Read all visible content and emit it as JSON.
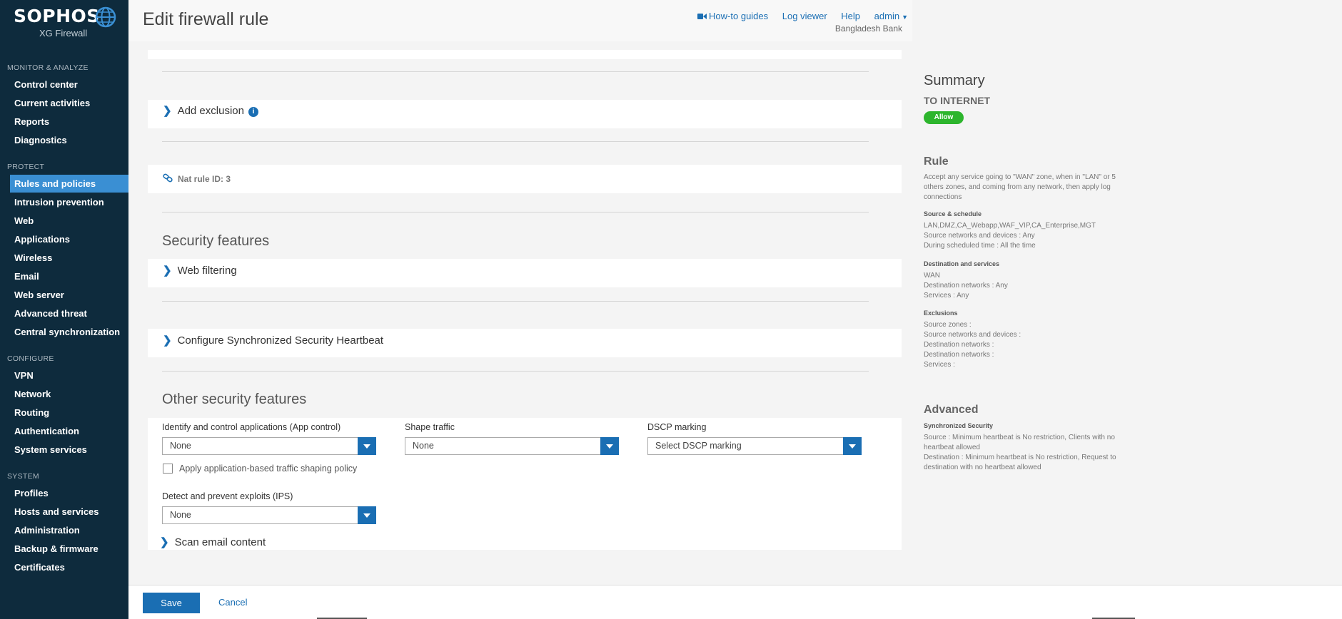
{
  "brand": {
    "name": "SOPHOS",
    "product": "XG Firewall"
  },
  "header": {
    "title": "Edit firewall rule",
    "links": {
      "howto": "How-to guides",
      "logviewer": "Log viewer",
      "help": "Help",
      "user": "admin"
    },
    "org": "Bangladesh Bank"
  },
  "nav": {
    "sections": {
      "monitor": "MONITOR & ANALYZE",
      "protect": "PROTECT",
      "configure": "CONFIGURE",
      "system": "SYSTEM"
    },
    "items": [
      "Control center",
      "Current activities",
      "Reports",
      "Diagnostics",
      "Rules and policies",
      "Intrusion prevention",
      "Web",
      "Applications",
      "Wireless",
      "Email",
      "Web server",
      "Advanced threat",
      "Central synchronization",
      "VPN",
      "Network",
      "Routing",
      "Authentication",
      "System services",
      "Profiles",
      "Hosts and services",
      "Administration",
      "Backup & firmware",
      "Certificates"
    ]
  },
  "main": {
    "add_exclusion": "Add exclusion",
    "nat_rule": "Nat rule ID: 3",
    "security_features": "Security features",
    "web_filtering": "Web filtering",
    "heartbeat": "Configure Synchronized Security Heartbeat",
    "other_features": "Other security features",
    "app_control_label": "Identify and control applications (App control)",
    "app_control_value": "None",
    "shape_traffic_label": "Shape traffic",
    "shape_traffic_value": "None",
    "dscp_label": "DSCP marking",
    "dscp_value": "Select DSCP marking",
    "app_shaping_checkbox": "Apply application-based traffic shaping policy",
    "ips_label": "Detect and prevent exploits (IPS)",
    "ips_value": "None",
    "scan_email": "Scan email content"
  },
  "summary": {
    "title": "Summary",
    "rule_name": "TO INTERNET",
    "action": "Allow",
    "rule_heading": "Rule",
    "rule_text": "Accept any service going to \"WAN\" zone, when in \"LAN\" or 5 others zones, and coming from any network, then apply log connections",
    "source_label": "Source & schedule",
    "source_zones": "LAN,DMZ,CA_Webapp,WAF_VIP,CA_Enterprise,MGT",
    "source_networks": "Source networks and devices : Any",
    "schedule": "During scheduled time : All the time",
    "dest_label": "Destination and services",
    "dest_zone": "WAN",
    "dest_networks": "Destination networks : Any",
    "services": "Services : Any",
    "excl_label": "Exclusions",
    "excl_source_zones": "Source zones :",
    "excl_source_networks": "Source networks and devices :",
    "excl_dest_networks_1": "Destination networks :",
    "excl_dest_networks_2": "Destination networks :",
    "excl_services": "Services :",
    "advanced_heading": "Advanced",
    "sync_label": "Synchronized Security",
    "sync_source": "Source : Minimum heartbeat is No restriction, Clients with no heartbeat allowed",
    "sync_dest": "Destination : Minimum heartbeat is No restriction, Request to destination with no heartbeat allowed"
  },
  "footer": {
    "save": "Save",
    "cancel": "Cancel"
  },
  "colors": {
    "sidebar": "#0e2b3d",
    "accent": "#1a6eb3",
    "active_nav": "#3a8fd3",
    "allow": "#2db52d"
  }
}
